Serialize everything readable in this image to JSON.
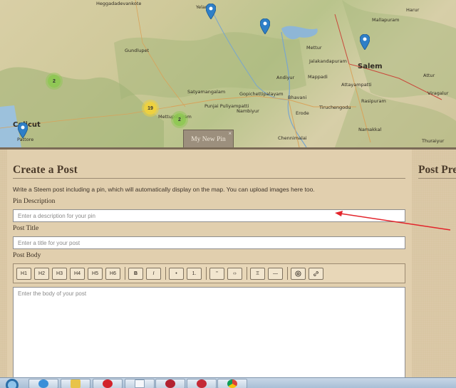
{
  "map": {
    "labels": [
      {
        "text": "Heggadadevankote"
      },
      {
        "text": "Yelandur"
      },
      {
        "text": "Mallapuram"
      },
      {
        "text": "Harur"
      },
      {
        "text": "Gundlupet"
      },
      {
        "text": "Mettur"
      },
      {
        "text": "Jalakandapuram"
      },
      {
        "text": "Mappadi"
      },
      {
        "text": "Salem"
      },
      {
        "text": "Andiyur"
      },
      {
        "text": "Attur"
      },
      {
        "text": "Attayampatti"
      },
      {
        "text": "Satyamangalam"
      },
      {
        "text": "Gopichettipalayam"
      },
      {
        "text": "Bhavani"
      },
      {
        "text": "Rasipuram"
      },
      {
        "text": "Viragalur"
      },
      {
        "text": "Punjai Puliyampatti"
      },
      {
        "text": "Nambiyur"
      },
      {
        "text": "Tiruchengodu"
      },
      {
        "text": "Mettupalayam"
      },
      {
        "text": "Erode"
      },
      {
        "text": "Calicut"
      },
      {
        "text": "Chennimalai"
      },
      {
        "text": "Namakkal"
      },
      {
        "text": "Thuraiyur"
      },
      {
        "text": "Pattore"
      }
    ],
    "clusters": [
      {
        "count": "2",
        "color": "#8cc850"
      },
      {
        "count": "19",
        "color": "#f0d23c"
      },
      {
        "count": "2",
        "color": "#8cc850"
      }
    ],
    "pin_color": "#2f7fc7",
    "tab_label": "My New Pin",
    "tab_close": "×"
  },
  "form": {
    "title": "Create a Post",
    "intro": "Write a Steem post including a pin, which will automatically display on the map. You can upload images here too.",
    "pin_description_label": "Pin Description",
    "pin_description_placeholder": "Enter a description for your pin",
    "post_title_label": "Post Title",
    "post_title_placeholder": "Enter a title for your post",
    "post_body_label": "Post Body",
    "post_body_placeholder": "Enter the body of your post",
    "toolbar": {
      "headings": [
        "H1",
        "H2",
        "H3",
        "H4",
        "H5",
        "H6"
      ],
      "bold": "B",
      "italic": "I",
      "bullet": "•",
      "numbered": "1.",
      "quote": "\"",
      "code": "‹›",
      "table": "Ξ",
      "rule": "—",
      "image_icon": "image-icon",
      "link_icon": "link-icon"
    }
  },
  "preview": {
    "title": "Post Preview"
  },
  "annotation": {
    "color": "#e3242b"
  },
  "taskbar": {
    "apps": [
      "internet-explorer",
      "file-explorer",
      "opera",
      "document",
      "red-app-1",
      "red-app-2",
      "chrome"
    ]
  }
}
